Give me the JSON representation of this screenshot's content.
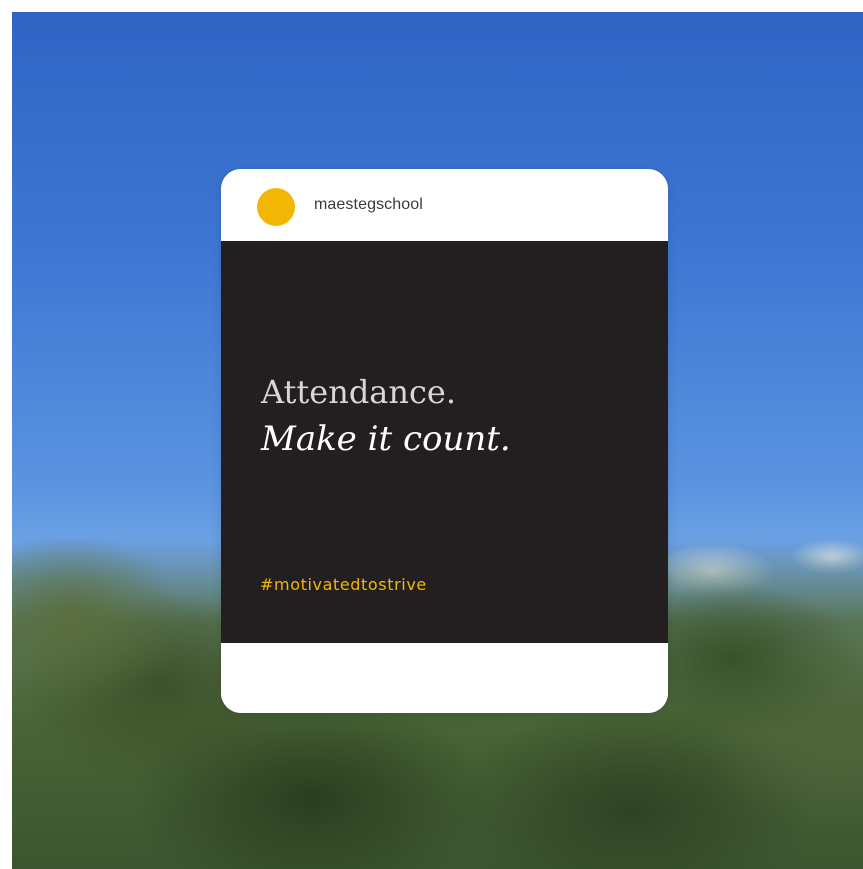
{
  "post": {
    "username": "maestegschool",
    "headline_line1": "Attendance.",
    "headline_line2": "Make it count.",
    "hashtag": "#motivatedtostrive"
  },
  "colors": {
    "avatar": "#f2b705",
    "post_background": "#231f20",
    "hashtag": "#f2b705",
    "headline_line1": "#d7d7d7",
    "headline_line2": "#ffffff"
  },
  "background": {
    "icon": "blurred-sky-and-trees-photo"
  }
}
